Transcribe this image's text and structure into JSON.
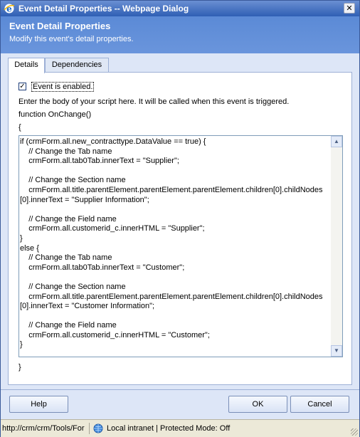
{
  "window": {
    "title": "Event Detail Properties -- Webpage Dialog",
    "close_label": "✕"
  },
  "header": {
    "title": "Event Detail Properties",
    "subtitle": "Modify this event's detail properties."
  },
  "tabs": [
    {
      "label": "Details",
      "active": true
    },
    {
      "label": "Dependencies",
      "active": false
    }
  ],
  "details": {
    "checkbox_checked": true,
    "checkbox_mark": "✓",
    "checkbox_label": "Event is enabled.",
    "instructions": "Enter the body of your script here. It will be called when this event is triggered.",
    "function_signature": "function OnChange()",
    "open_brace": "{",
    "close_brace": "}",
    "script": "if (crmForm.all.new_contracttype.DataValue == true) {\n    // Change the Tab name\n    crmForm.all.tab0Tab.innerText = \"Supplier\";\n\n    // Change the Section name\n    crmForm.all.title.parentElement.parentElement.parentElement.children[0].childNodes\n[0].innerText = \"Supplier Information\";\n\n    // Change the Field name\n    crmForm.all.customerid_c.innerHTML = \"Supplier\";\n}\nelse {\n    // Change the Tab name\n    crmForm.all.tab0Tab.innerText = \"Customer\";\n\n    // Change the Section name\n    crmForm.all.title.parentElement.parentElement.parentElement.children[0].childNodes\n[0].innerText = \"Customer Information\";\n\n    // Change the Field name\n    crmForm.all.customerid_c.innerHTML = \"Customer\";\n}"
  },
  "scrollbar": {
    "up_arrow": "▲",
    "down_arrow": "▼"
  },
  "buttons": {
    "help": "Help",
    "ok": "OK",
    "cancel": "Cancel"
  },
  "statusbar": {
    "url": "http://crm/crm/Tools/For",
    "zone": "Local intranet | Protected Mode: Off"
  }
}
